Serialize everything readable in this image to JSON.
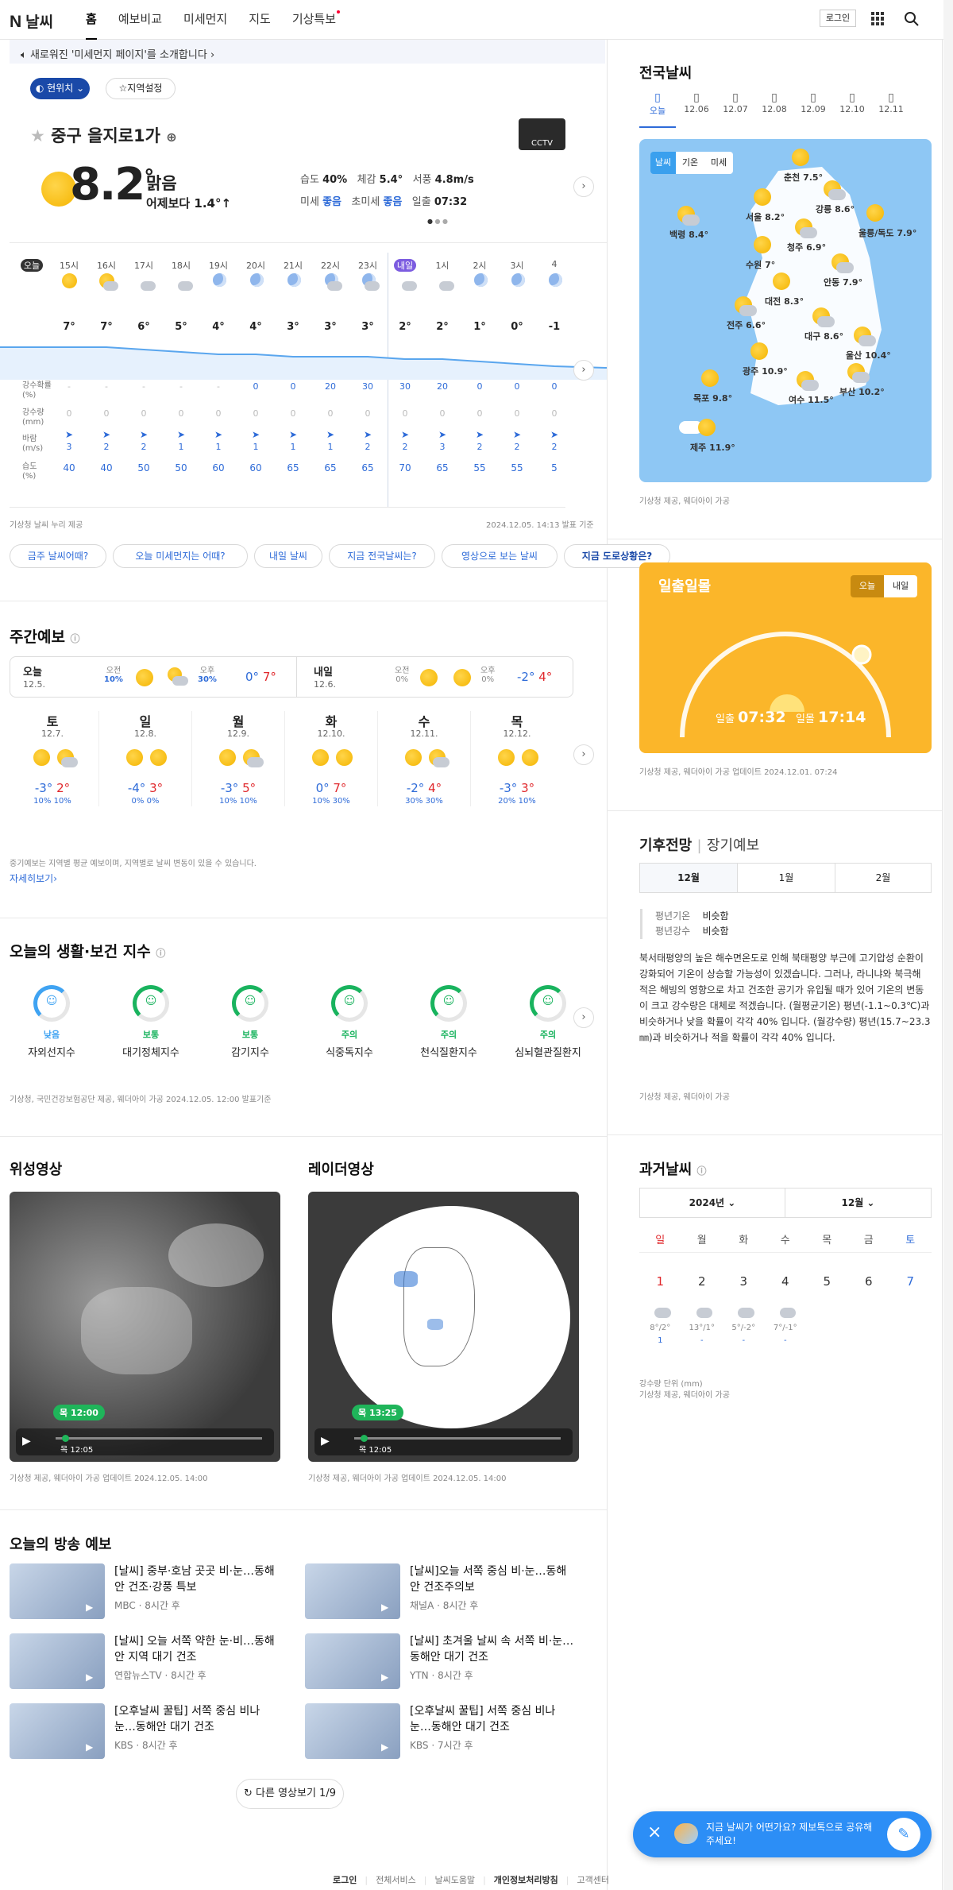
{
  "header": {
    "logo": "N",
    "title": "날씨",
    "nav": [
      "홈",
      "예보비교",
      "미세먼지",
      "지도",
      "기상특보"
    ],
    "login": "로그인"
  },
  "notice": "새로워진 '미세먼지 페이지'를 소개합니다",
  "loc_btn": "현위치",
  "region_btn": "지역설정",
  "location": "중구 을지로1가",
  "cctv": "CCTV",
  "current": {
    "temp": "8.2",
    "unit": "°",
    "cond": "맑음",
    "diff": "어제보다 1.4°↑",
    "humid_l": "습도",
    "humid": "40%",
    "feel_l": "체감",
    "feel": "5.4°",
    "wind_l": "서풍",
    "wind": "4.8m/s",
    "dust_l": "미세",
    "dust": "좋음",
    "fdust_l": "초미세",
    "fdust": "좋음",
    "sunrise_l": "일출",
    "sunrise": "07:32"
  },
  "hourly": {
    "times": [
      "오늘",
      "15시",
      "16시",
      "17시",
      "18시",
      "19시",
      "20시",
      "21시",
      "22시",
      "23시",
      "내일",
      "1시",
      "2시",
      "3시",
      "4"
    ],
    "icons": [
      "",
      "sun",
      "suncloud",
      "cloud",
      "cloud",
      "moon",
      "moon",
      "moon",
      "cloudmoon",
      "cloudmoon",
      "cloud",
      "cloud",
      "moon",
      "moon",
      "moon"
    ],
    "temps": [
      "",
      "7°",
      "7°",
      "6°",
      "5°",
      "4°",
      "4°",
      "3°",
      "3°",
      "3°",
      "2°",
      "2°",
      "1°",
      "0°",
      "-1"
    ],
    "temp_values": [
      null,
      7,
      7,
      6,
      5,
      4,
      4,
      3,
      3,
      3,
      2,
      2,
      1,
      0,
      -1
    ],
    "rain_prob": [
      "",
      "-",
      "-",
      "-",
      "-",
      "-",
      "0",
      "0",
      "20",
      "30",
      "30",
      "20",
      "0",
      "0",
      "0"
    ],
    "rain_amt": [
      "",
      "0",
      "0",
      "0",
      "0",
      "0",
      "0",
      "0",
      "0",
      "0",
      "0",
      "0",
      "0",
      "0",
      "0"
    ],
    "wind": [
      "",
      "3",
      "2",
      "2",
      "1",
      "1",
      "1",
      "1",
      "1",
      "2",
      "2",
      "3",
      "2",
      "2",
      "2"
    ],
    "humid": [
      "",
      "40",
      "40",
      "50",
      "50",
      "60",
      "60",
      "65",
      "65",
      "65",
      "70",
      "65",
      "55",
      "55",
      "5"
    ],
    "labels": {
      "rain_prob": "강수확률\n(%)",
      "rain_amt": "강수량\n(mm)",
      "wind": "바람\n(m/s)",
      "humid": "습도\n(%)"
    },
    "footer_left": "기상청 날씨 누리 제공",
    "footer_right": "2024.12.05. 14:13 발표 기준"
  },
  "chips": [
    "금주 날씨어때?",
    "오늘 미세먼지는 어때?",
    "내일 날씨",
    "지금 전국날씨는?",
    "영상으로 보는 날씨",
    "지금 도로상황은?"
  ],
  "weekly": {
    "title": "주간예보",
    "today": {
      "d": "오늘",
      "date": "12.5.",
      "am_l": "오전",
      "am": "10%",
      "pm_l": "오후",
      "pm": "30%",
      "lo": "0°",
      "hi": "7°"
    },
    "tomorrow": {
      "d": "내일",
      "date": "12.6.",
      "am_l": "오전",
      "am": "0%",
      "pm_l": "오후",
      "pm": "0%",
      "lo": "-2°",
      "hi": "4°"
    },
    "days": [
      {
        "d": "토",
        "date": "12.7.",
        "lo": "-3°",
        "hi": "2°",
        "am": "10%",
        "pm": "10%"
      },
      {
        "d": "일",
        "date": "12.8.",
        "lo": "-4°",
        "hi": "3°",
        "am": "0%",
        "pm": "0%"
      },
      {
        "d": "월",
        "date": "12.9.",
        "lo": "-3°",
        "hi": "5°",
        "am": "10%",
        "pm": "10%"
      },
      {
        "d": "화",
        "date": "12.10.",
        "lo": "0°",
        "hi": "7°",
        "am": "10%",
        "pm": "30%"
      },
      {
        "d": "수",
        "date": "12.11.",
        "lo": "-2°",
        "hi": "4°",
        "am": "30%",
        "pm": "30%"
      },
      {
        "d": "목",
        "date": "12.12.",
        "lo": "-3°",
        "hi": "3°",
        "am": "20%",
        "pm": "10%"
      }
    ],
    "note": "중기예보는 지역별 평균 예보이며, 지역별로 날씨 변동이 있을 수 있습니다.",
    "more": "자세히보기"
  },
  "index": {
    "title": "오늘의 생활·보건 지수",
    "items": [
      {
        "lv": "낮음",
        "name": "자외선지수"
      },
      {
        "lv": "보통",
        "name": "대기정체지수"
      },
      {
        "lv": "보통",
        "name": "감기지수"
      },
      {
        "lv": "주의",
        "name": "식중독지수"
      },
      {
        "lv": "주의",
        "name": "천식질환지수"
      },
      {
        "lv": "주의",
        "name": "심뇌혈관질환지"
      }
    ],
    "source": "기상청, 국민건강보험공단 제공, 웨더아이 가공 2024.12.05. 12:00 발표기준"
  },
  "satellite": {
    "title": "위성영상",
    "time": "목 12:00",
    "date": "목 12:05",
    "source": "기상청 제공, 웨더아이 가공 업데이트 2024.12.05. 14:00"
  },
  "radar": {
    "title": "레이더영상",
    "time": "목 13:25",
    "date": "목 12:05",
    "source": "기상청 제공, 웨더아이 가공 업데이트 2024.12.05. 14:00"
  },
  "broadcast": {
    "title": "오늘의 방송 예보",
    "items": [
      {
        "t": "[날씨] 중부·호남 곳곳 비·눈…동해안 건조·강풍 특보",
        "m": "MBC · 8시간 후"
      },
      {
        "t": "[날씨]오늘 서쪽 중심 비·눈…동해안 건조주의보",
        "m": "채널A · 8시간 후"
      },
      {
        "t": "[날씨] 오늘 서쪽 약한 눈·비…동해안 지역 대기 건조",
        "m": "연합뉴스TV · 8시간 후"
      },
      {
        "t": "[날씨] 초겨울 날씨 속 서쪽 비·눈…동해안 대기 건조",
        "m": "YTN · 8시간 후"
      },
      {
        "t": "[오후날씨 꿀팁] 서쪽 중심 비나 눈…동해안 대기 건조",
        "m": "KBS · 8시간 후"
      },
      {
        "t": "[오후날씨 꿀팁] 서쪽 중심 비나 눈…동해안 대기 건조",
        "m": "KBS · 7시간 후"
      }
    ],
    "more": "다른 영상보기 1/9"
  },
  "national": {
    "title": "전국날씨",
    "tabs": [
      "오늘",
      "12.06",
      "12.07",
      "12.08",
      "12.09",
      "12.10",
      "12.11"
    ],
    "toggle": [
      "날씨",
      "기온",
      "미세"
    ],
    "cities": [
      {
        "n": "춘천",
        "t": "7.5°"
      },
      {
        "n": "서울",
        "t": "8.2°"
      },
      {
        "n": "강릉",
        "t": "8.6°"
      },
      {
        "n": "백령",
        "t": "8.4°"
      },
      {
        "n": "울릉/독도",
        "t": "7.9°"
      },
      {
        "n": "청주",
        "t": "6.9°"
      },
      {
        "n": "수원",
        "t": "7°"
      },
      {
        "n": "안동",
        "t": "7.9°"
      },
      {
        "n": "대전",
        "t": "8.3°"
      },
      {
        "n": "전주",
        "t": "6.6°"
      },
      {
        "n": "대구",
        "t": "8.6°"
      },
      {
        "n": "울산",
        "t": "10.4°"
      },
      {
        "n": "광주",
        "t": "10.9°"
      },
      {
        "n": "여수",
        "t": "11.5°"
      },
      {
        "n": "부산",
        "t": "10.2°"
      },
      {
        "n": "목포",
        "t": "9.8°"
      },
      {
        "n": "제주",
        "t": "11.9°"
      }
    ],
    "source": "기상청 제공, 웨더아이 가공"
  },
  "sun": {
    "title": "일출일몰",
    "toggle": [
      "오늘",
      "내일"
    ],
    "rise_l": "일출",
    "rise": "07:32",
    "set_l": "일몰",
    "set": "17:14",
    "source": "기상청 제공, 웨더아이 가공 업데이트 2024.12.01. 07:24"
  },
  "outlook": {
    "tabs": [
      "기후전망",
      "장기예보"
    ],
    "months": [
      "12월",
      "1월",
      "2월"
    ],
    "avg_t_l": "평년기온",
    "avg_t": "비슷함",
    "avg_r_l": "평년강수",
    "avg_r": "비슷함",
    "text": "북서태평양의 높은 해수면온도로 인해 북태평양 부근에 고기압성 순환이 강화되어 기온이 상승할 가능성이 있겠습니다. 그러나, 라니냐와 북극해 적은 해빙의 영향으로 차고 건조한 공기가 유입될 때가 있어 기온의 변동이 크고 강수량은 대체로 적겠습니다. (월평균기온) 평년(-1.1~0.3℃)과 비슷하거나 낮을 확률이 각각 40% 입니다. (월강수량) 평년(15.7~23.3㎜)과 비슷하거나 적을 확률이 각각 40% 입니다.",
    "source": "기상청 제공, 웨더아이 가공"
  },
  "past": {
    "title": "과거날씨",
    "year": "2024년",
    "month": "12월",
    "dows": [
      "일",
      "월",
      "화",
      "수",
      "목",
      "금",
      "토"
    ],
    "days": [
      "1",
      "2",
      "3",
      "4",
      "5",
      "6",
      "7"
    ],
    "temps": [
      "8°/2°",
      "13°/1°",
      "5°/-2°",
      "7°/-1°"
    ],
    "rain": [
      "1",
      "-",
      "-",
      "-"
    ],
    "note": "강수량 단위 (mm)",
    "source": "기상청 제공, 웨더아이 가공"
  },
  "fab": {
    "text": "지금 날씨가 어떤가요? 제보톡으로 공유해 주세요!"
  },
  "footer": [
    "로그인",
    "전체서비스",
    "날씨도움말",
    "개인정보처리방침",
    "고객센터"
  ]
}
